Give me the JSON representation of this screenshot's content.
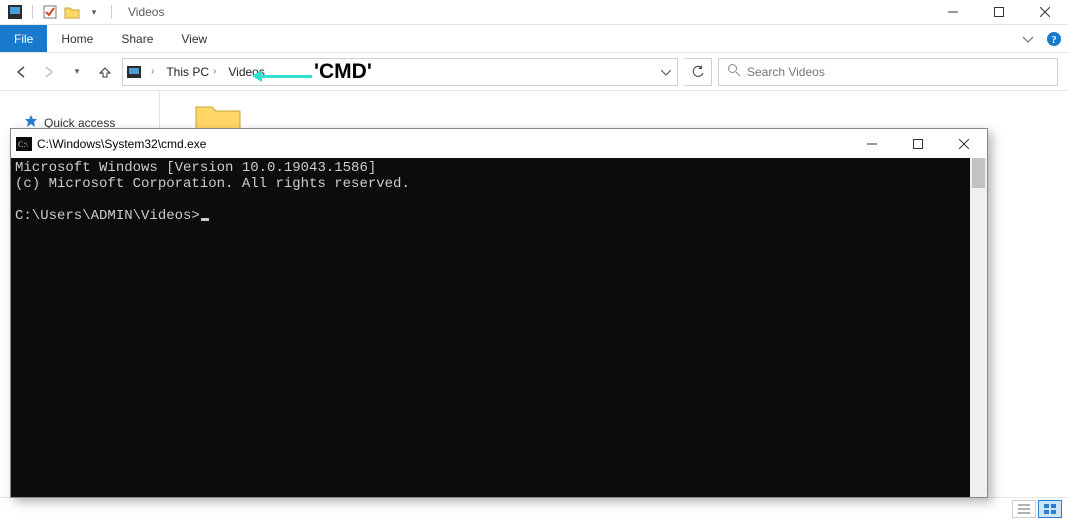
{
  "explorer": {
    "title": "Videos",
    "ribbon": {
      "file": "File",
      "home": "Home",
      "share": "Share",
      "view": "View"
    },
    "breadcrumb": {
      "root": "This PC",
      "current": "Videos"
    },
    "search_placeholder": "Search Videos",
    "sidebar": {
      "quick_access": "Quick access"
    }
  },
  "annotation": {
    "label": "'CMD'"
  },
  "cmd": {
    "title": "C:\\Windows\\System32\\cmd.exe",
    "line1": "Microsoft Windows [Version 10.0.19043.1586]",
    "line2": "(c) Microsoft Corporation. All rights reserved.",
    "prompt": "C:\\Users\\ADMIN\\Videos>"
  }
}
